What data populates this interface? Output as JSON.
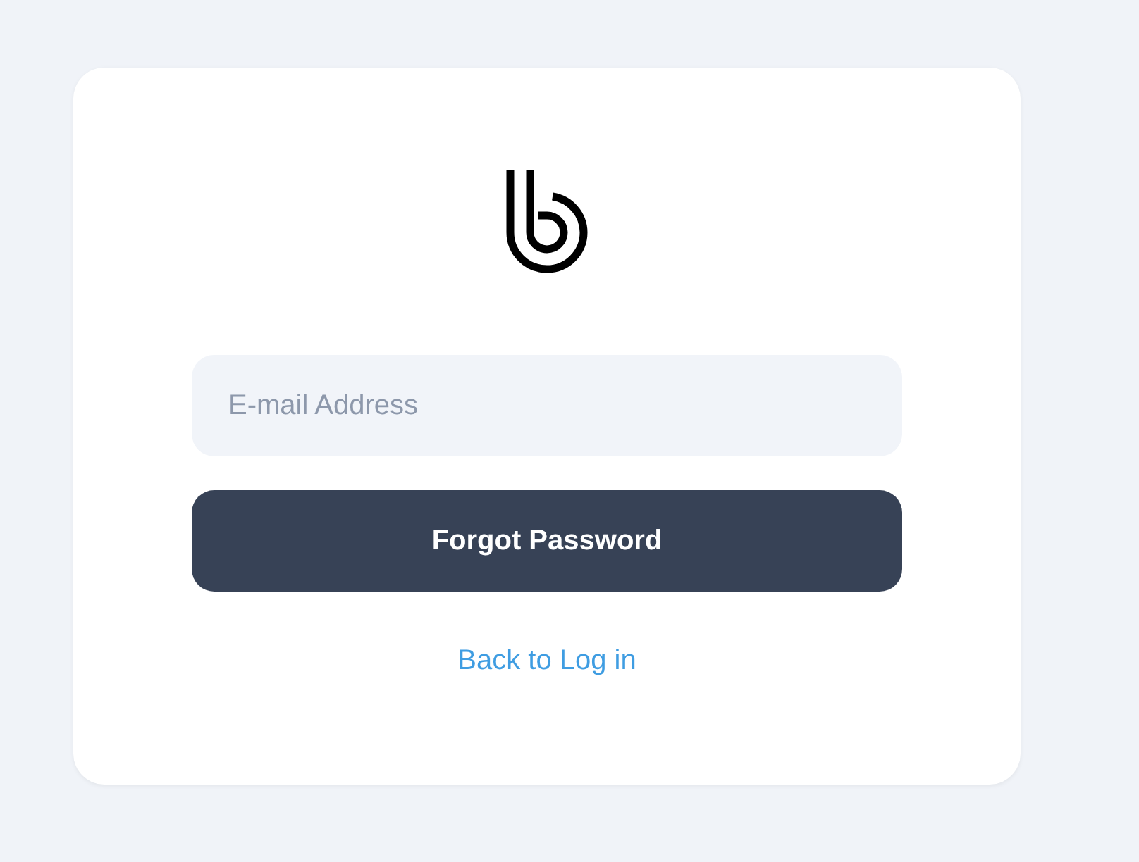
{
  "form": {
    "email": {
      "placeholder": "E-mail Address"
    },
    "submit": "Forgot Password",
    "back_link": "Back to Log in"
  }
}
